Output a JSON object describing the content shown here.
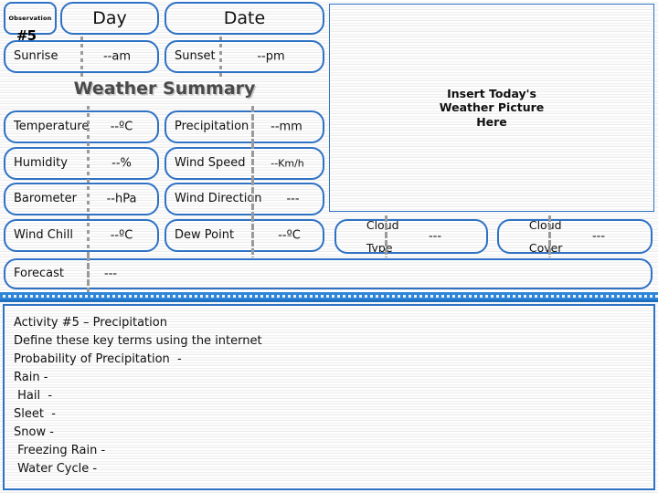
{
  "header": {
    "observation_label": "Observation",
    "observation_number": "#5",
    "day_label": "Day",
    "date_label": "Date",
    "sunrise_label": "Sunrise",
    "sunrise_value": "--am",
    "sunset_label": "Sunset",
    "sunset_value": "--pm"
  },
  "summary": {
    "title": "Weather Summary",
    "fields": [
      {
        "label": "Temperature",
        "value": "--ºC"
      },
      {
        "label": "Precipitation",
        "value": "--mm"
      },
      {
        "label": "Humidity",
        "value": "--%"
      },
      {
        "label": "Wind Speed",
        "value": "--Km/h"
      },
      {
        "label": "Barometer",
        "value": "--hPa"
      },
      {
        "label": "Wind Direction",
        "value": "---"
      },
      {
        "label": "Wind Chill",
        "value": "--ºC"
      },
      {
        "label": "Dew Point",
        "value": "--ºC"
      }
    ],
    "forecast_label": "Forecast",
    "forecast_value": "---"
  },
  "picture": {
    "placeholder_line1": "Insert Today's",
    "placeholder_line2": "Weather Picture",
    "placeholder_line3": "Here"
  },
  "clouds": {
    "type_label_line1": "Cloud",
    "type_label_line2": "Type",
    "type_value": "---",
    "cover_label_line1": "Cloud",
    "cover_label_line2": "Cover",
    "cover_value": "---"
  },
  "activity": {
    "lines": [
      "Activity #5 – Precipitation",
      "Define these key terms using the internet",
      "Probability of Precipitation  -",
      "Rain -",
      " Hail  -",
      "Sleet  -",
      "Snow -",
      " Freezing Rain -",
      " Water Cycle -"
    ]
  },
  "colors": {
    "box_border_blue": "#2f72c4",
    "divider_blue": "#2f86d8",
    "title_gray": "#4a4a4a",
    "text_black": "#111111"
  }
}
